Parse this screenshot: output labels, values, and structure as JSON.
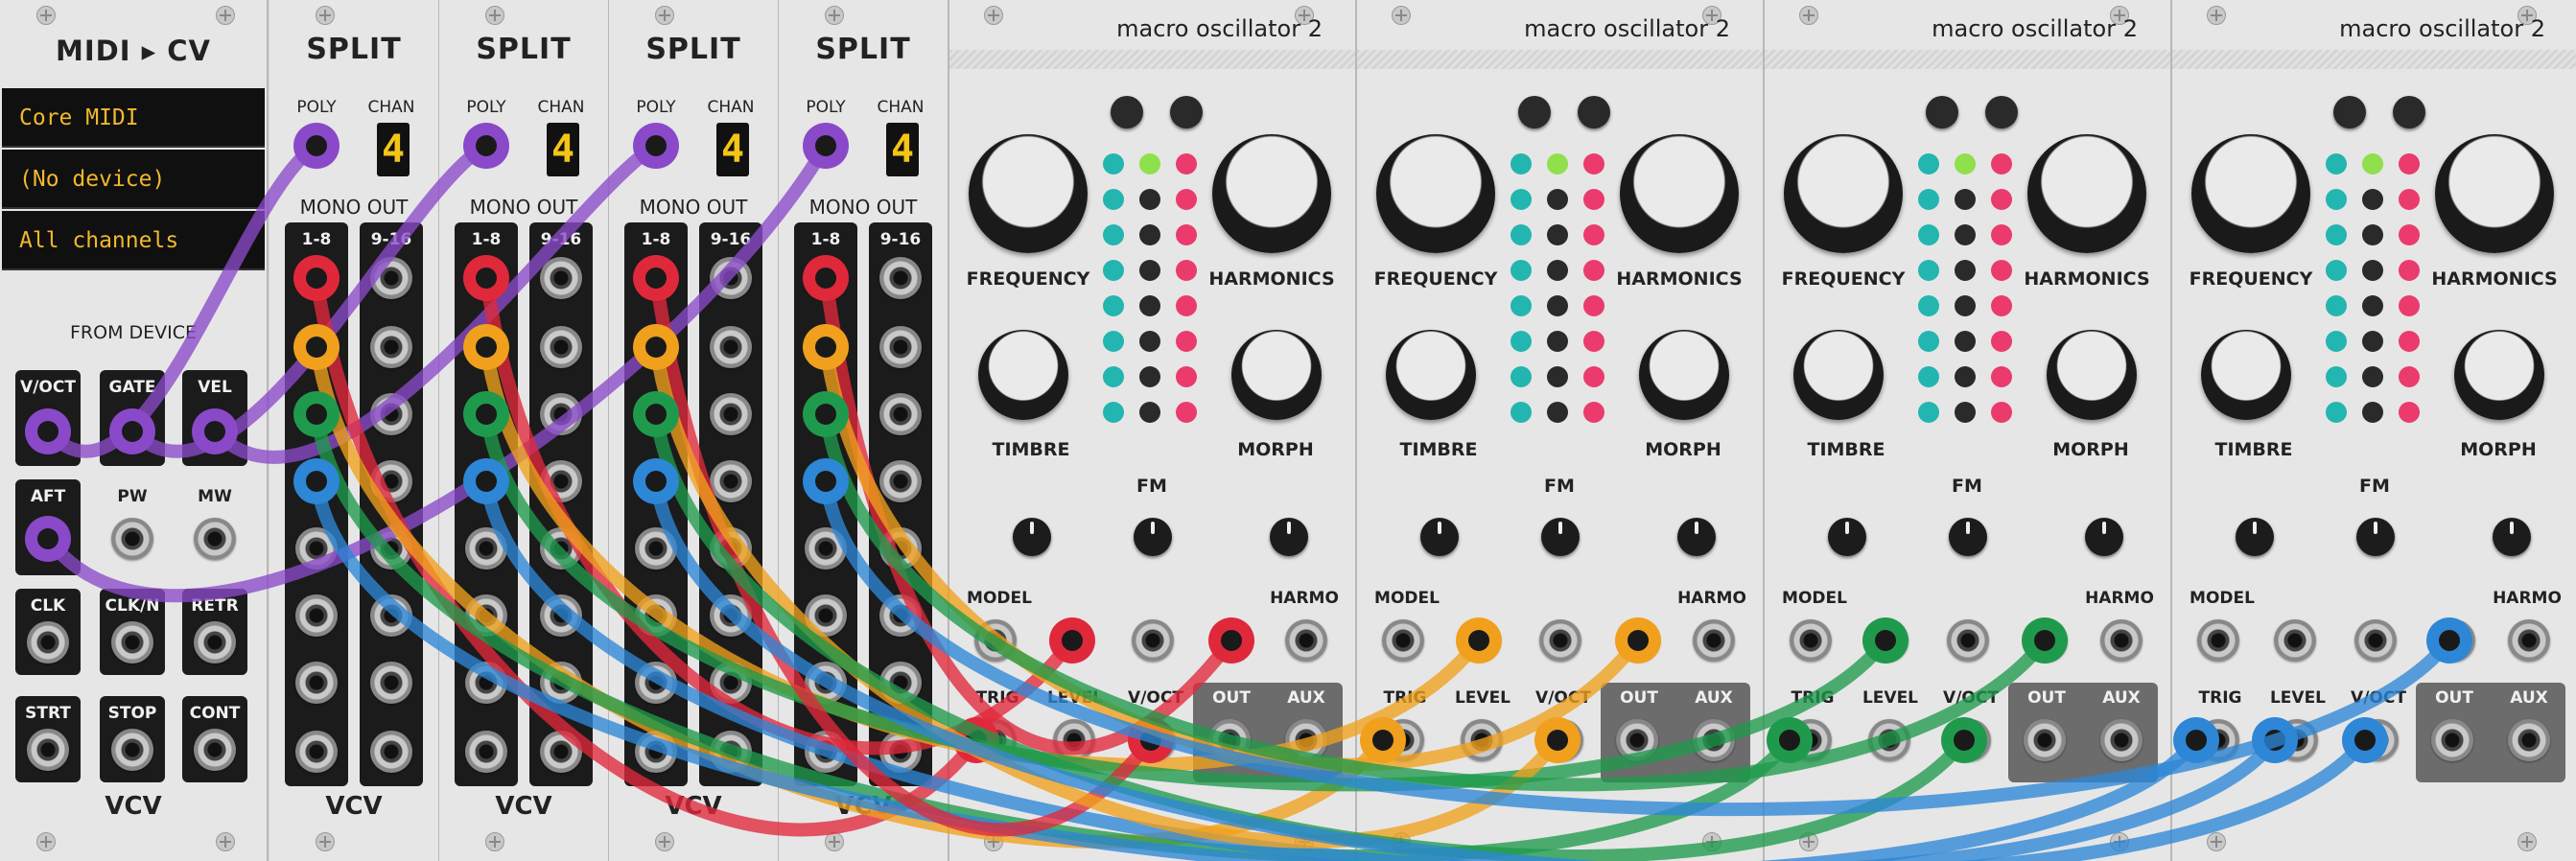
{
  "midi": {
    "title": "MIDI ▸ CV",
    "driver": "Core MIDI",
    "device": "(No device)",
    "channel": "All channels",
    "from_device": "FROM DEVICE",
    "jacks": [
      "V/OCT",
      "GATE",
      "VEL",
      "AFT",
      "PW",
      "MW",
      "CLK",
      "CLK/N",
      "RETR",
      "STRT",
      "STOP",
      "CONT"
    ],
    "brand": "VCV"
  },
  "split_modules": [
    {
      "title": "SPLIT",
      "poly": "POLY",
      "chan": "CHAN",
      "chan_value": "4",
      "mono_out": "MONO OUT",
      "range_a": "1-8",
      "range_b": "9-16",
      "brand": "VCV"
    },
    {
      "title": "SPLIT",
      "poly": "POLY",
      "chan": "CHAN",
      "chan_value": "4",
      "mono_out": "MONO OUT",
      "range_a": "1-8",
      "range_b": "9-16",
      "brand": "VCV"
    },
    {
      "title": "SPLIT",
      "poly": "POLY",
      "chan": "CHAN",
      "chan_value": "4",
      "mono_out": "MONO OUT",
      "range_a": "1-8",
      "range_b": "9-16",
      "brand": "VCV"
    },
    {
      "title": "SPLIT",
      "poly": "POLY",
      "chan": "CHAN",
      "chan_value": "4",
      "mono_out": "MONO OUT",
      "range_a": "1-8",
      "range_b": "9-16",
      "brand": "VCV"
    }
  ],
  "oscillators": [
    {
      "title": "macro oscillator 2",
      "frequency": "FREQUENCY",
      "harmonics": "HARMONICS",
      "timbre": "TIMBRE",
      "morph": "MORPH",
      "fm": "FM",
      "model": "MODEL",
      "harmo": "HARMO",
      "trig": "TRIG",
      "level": "LEVEL",
      "voct": "V/OCT",
      "out": "OUT",
      "aux": "AUX"
    },
    {
      "title": "macro oscillator 2",
      "frequency": "FREQUENCY",
      "harmonics": "HARMONICS",
      "timbre": "TIMBRE",
      "morph": "MORPH",
      "fm": "FM",
      "model": "MODEL",
      "harmo": "HARMO",
      "trig": "TRIG",
      "level": "LEVEL",
      "voct": "V/OCT",
      "out": "OUT",
      "aux": "AUX"
    },
    {
      "title": "macro oscillator 2",
      "frequency": "FREQUENCY",
      "harmonics": "HARMONICS",
      "timbre": "TIMBRE",
      "morph": "MORPH",
      "fm": "FM",
      "model": "MODEL",
      "harmo": "HARMO",
      "trig": "TRIG",
      "level": "LEVEL",
      "voct": "V/OCT",
      "out": "OUT",
      "aux": "AUX"
    },
    {
      "title": "macro oscillator 2",
      "frequency": "FREQUENCY",
      "harmonics": "HARMONICS",
      "timbre": "TIMBRE",
      "morph": "MORPH",
      "fm": "FM",
      "model": "MODEL",
      "harmo": "HARMO",
      "trig": "TRIG",
      "level": "LEVEL",
      "voct": "V/OCT",
      "out": "OUT",
      "aux": "AUX"
    }
  ],
  "colors": {
    "purple_cable": "#8a49c9",
    "red_cable": "#e0283b",
    "orange_cable": "#f0a01c",
    "green_cable": "#1f9a4c",
    "blue_cable": "#2d86d6",
    "led_teal": "#23b5b0",
    "led_pink": "#ea3b6c",
    "led_green": "#8fe04c",
    "display_amber": "#f1b82b"
  }
}
